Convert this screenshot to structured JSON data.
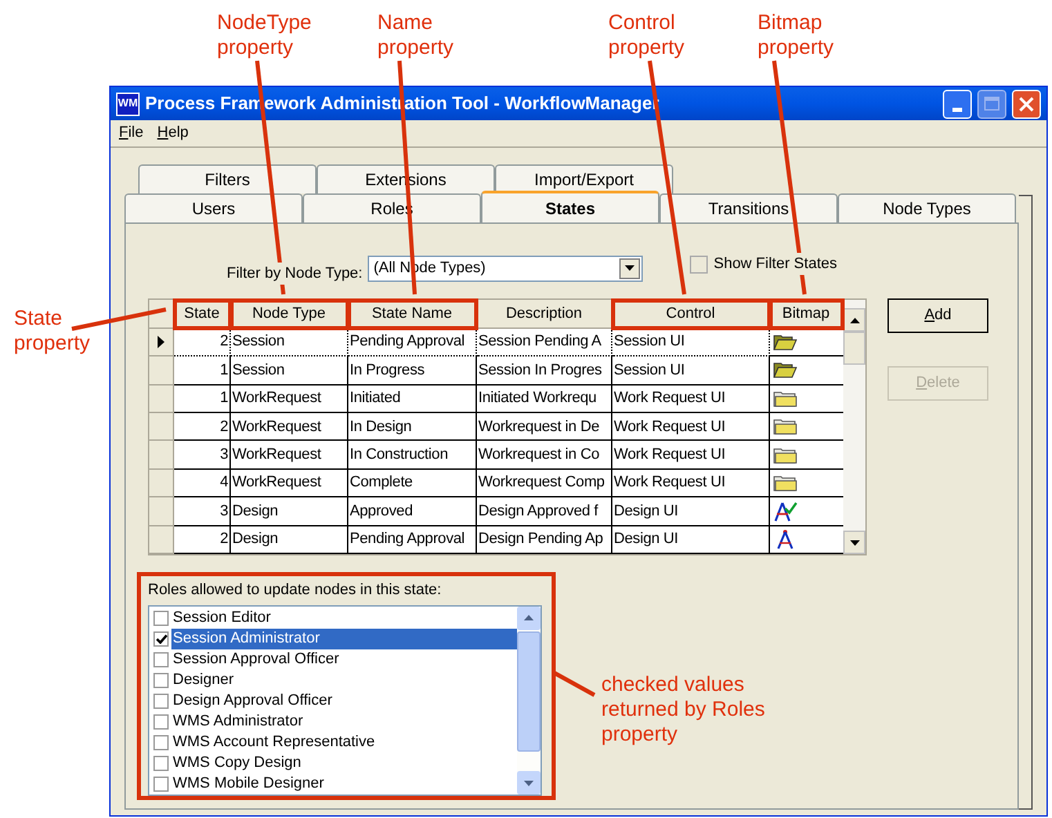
{
  "annotations": [
    {
      "kind": "state",
      "text": "State\nproperty"
    },
    {
      "kind": "nodetype",
      "text": "NodeType\nproperty"
    },
    {
      "kind": "name",
      "text": "Name\nproperty"
    },
    {
      "kind": "control",
      "text": "Control\nproperty"
    },
    {
      "kind": "bitmap",
      "text": "Bitmap\nproperty"
    },
    {
      "kind": "roles",
      "text": "checked values\nreturned by Roles\nproperty"
    }
  ],
  "window": {
    "title": "Process Framework Administration Tool - WorkflowManager",
    "icon_text": "WM"
  },
  "menu": [
    "File",
    "Help"
  ],
  "tabs_back": [
    {
      "label": "Filters",
      "selected": false
    },
    {
      "label": "Extensions",
      "selected": false
    },
    {
      "label": "Import/Export",
      "selected": false
    }
  ],
  "tabs_front": [
    {
      "label": "Users",
      "selected": false
    },
    {
      "label": "Roles",
      "selected": false
    },
    {
      "label": "States",
      "selected": true
    },
    {
      "label": "Transitions",
      "selected": false
    },
    {
      "label": "Node Types",
      "selected": false
    }
  ],
  "filter": {
    "label": "Filter by Node Type:",
    "value": "(All Node Types)"
  },
  "show_filter_states": {
    "label": "Show Filter States",
    "checked": false
  },
  "table": {
    "columns": [
      {
        "label": "State",
        "highlighted": true
      },
      {
        "label": "Node Type",
        "highlighted": true
      },
      {
        "label": "State Name",
        "highlighted": true
      },
      {
        "label": "Description",
        "highlighted": false
      },
      {
        "label": "Control",
        "highlighted": true
      },
      {
        "label": "Bitmap",
        "highlighted": true
      }
    ],
    "rows": [
      {
        "current": true,
        "state": "2",
        "node_type": "Session",
        "name": "Pending Approval",
        "description": "Session Pending A",
        "control": "Session UI",
        "kind": "folder-open"
      },
      {
        "current": false,
        "state": "1",
        "node_type": "Session",
        "name": "In Progress",
        "description": "Session In Progres",
        "control": "Session UI",
        "kind": "folder-open"
      },
      {
        "current": false,
        "state": "1",
        "node_type": "WorkRequest",
        "name": "Initiated",
        "description": "Initiated Workrequ",
        "control": "Work Request UI",
        "kind": "folder"
      },
      {
        "current": false,
        "state": "2",
        "node_type": "WorkRequest",
        "name": "In Design",
        "description": "Workrequest in De",
        "control": "Work Request UI",
        "kind": "folder"
      },
      {
        "current": false,
        "state": "3",
        "node_type": "WorkRequest",
        "name": "In Construction",
        "description": "Workrequest in Co",
        "control": "Work Request UI",
        "kind": "folder"
      },
      {
        "current": false,
        "state": "4",
        "node_type": "WorkRequest",
        "name": "Complete",
        "description": "Workrequest Comp",
        "control": "Work Request UI",
        "kind": "folder"
      },
      {
        "current": false,
        "state": "3",
        "node_type": "Design",
        "name": "Approved",
        "description": "Design Approved f",
        "control": "Design UI",
        "kind": "compass-check"
      },
      {
        "current": false,
        "state": "2",
        "node_type": "Design",
        "name": "Pending Approval",
        "description": "Design Pending Ap",
        "control": "Design UI",
        "kind": "compass"
      }
    ]
  },
  "buttons": [
    {
      "label": "Add",
      "disabled": false
    },
    {
      "label": "Delete",
      "disabled": true
    }
  ],
  "roles": {
    "label": "Roles allowed to update nodes in this state:",
    "highlighted": true,
    "items": [
      {
        "label": "Session Editor",
        "checked": false,
        "selected": false
      },
      {
        "label": "Session Administrator",
        "checked": true,
        "selected": true
      },
      {
        "label": "Session Approval Officer",
        "checked": false,
        "selected": false
      },
      {
        "label": "Designer",
        "checked": false,
        "selected": false
      },
      {
        "label": "Design Approval Officer",
        "checked": false,
        "selected": false
      },
      {
        "label": "WMS Administrator",
        "checked": false,
        "selected": false
      },
      {
        "label": "WMS Account Representative",
        "checked": false,
        "selected": false
      },
      {
        "label": "WMS Copy Design",
        "checked": false,
        "selected": false
      },
      {
        "label": "WMS Mobile Designer",
        "checked": false,
        "selected": false
      }
    ]
  }
}
